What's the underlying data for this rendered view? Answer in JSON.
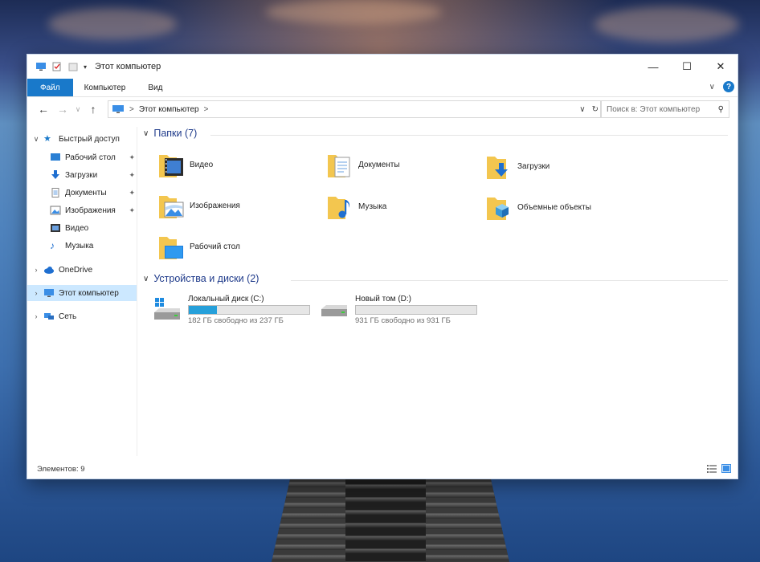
{
  "window": {
    "title": "Этот компьютер",
    "controls": {
      "minimize": "—",
      "maximize": "☐",
      "close": "✕"
    }
  },
  "ribbon": {
    "tabs": [
      {
        "label": "Файл",
        "active": true
      },
      {
        "label": "Компьютер"
      },
      {
        "label": "Вид"
      }
    ],
    "expand": "∨",
    "help": "?"
  },
  "nav": {
    "back": "←",
    "forward": "→",
    "recent": "∨",
    "up": "↑",
    "breadcrumb": [
      "Этот компьютер"
    ],
    "separator": ">",
    "refresh": "↻",
    "dropdown": "∨",
    "search_placeholder": "Поиск в: Этот компьютер"
  },
  "sidebar": {
    "quick_access": {
      "label": "Быстрый доступ",
      "items": [
        {
          "label": "Рабочий стол",
          "pinned": true,
          "icon": "desktop-icon"
        },
        {
          "label": "Загрузки",
          "pinned": true,
          "icon": "download-icon"
        },
        {
          "label": "Документы",
          "pinned": true,
          "icon": "document-icon"
        },
        {
          "label": "Изображения",
          "pinned": true,
          "icon": "image-icon"
        },
        {
          "label": "Видео",
          "pinned": false,
          "icon": "video-icon"
        },
        {
          "label": "Музыка",
          "pinned": false,
          "icon": "music-icon"
        }
      ]
    },
    "onedrive": "OneDrive",
    "this_pc": "Этот компьютер",
    "network": "Сеть",
    "pin_glyph": "📌"
  },
  "folders": {
    "header": "Папки (7)",
    "items": [
      {
        "label": "Видео",
        "icon": "video-folder-icon"
      },
      {
        "label": "Документы",
        "icon": "documents-folder-icon"
      },
      {
        "label": "Загрузки",
        "icon": "downloads-folder-icon"
      },
      {
        "label": "Изображения",
        "icon": "pictures-folder-icon"
      },
      {
        "label": "Музыка",
        "icon": "music-folder-icon"
      },
      {
        "label": "Объемные объекты",
        "icon": "3d-objects-folder-icon"
      },
      {
        "label": "Рабочий стол",
        "icon": "desktop-folder-icon"
      }
    ]
  },
  "drives": {
    "header": "Устройства и диски (2)",
    "items": [
      {
        "label": "Локальный диск (C:)",
        "free": "182 ГБ свободно из 237 ГБ",
        "used_fraction": 0.23,
        "system": true
      },
      {
        "label": "Новый том (D:)",
        "free": "931 ГБ свободно из 931 ГБ",
        "used_fraction": 0.0,
        "system": false
      }
    ]
  },
  "status": {
    "items_count": "Элементов: 9"
  },
  "colors": {
    "accent": "#1979ca",
    "folder": "#f3c64f",
    "selection": "#cce8ff",
    "drive_bar": "#26a0da"
  }
}
